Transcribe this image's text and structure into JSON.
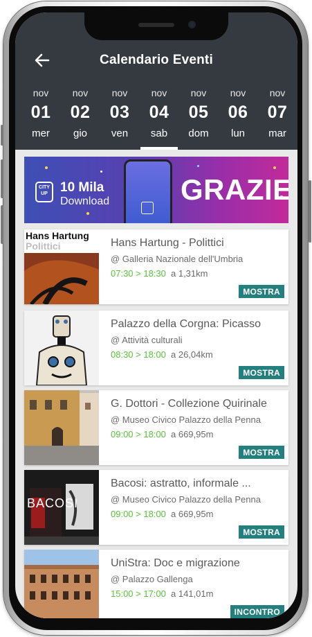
{
  "header": {
    "title": "Calendario Eventi",
    "days": [
      {
        "month": "nov",
        "num": "01",
        "weekday": "mer",
        "active": false
      },
      {
        "month": "nov",
        "num": "02",
        "weekday": "gio",
        "active": false
      },
      {
        "month": "nov",
        "num": "03",
        "weekday": "ven",
        "active": false
      },
      {
        "month": "nov",
        "num": "04",
        "weekday": "sab",
        "active": true
      },
      {
        "month": "nov",
        "num": "05",
        "weekday": "dom",
        "active": false
      },
      {
        "month": "nov",
        "num": "06",
        "weekday": "lun",
        "active": false
      },
      {
        "month": "nov",
        "num": "07",
        "weekday": "mar",
        "active": false
      }
    ]
  },
  "banner": {
    "logo_line1": "CITY",
    "logo_line2": "UP",
    "mila": "10 Mila",
    "download": "Download",
    "grazie": "GRAZIE"
  },
  "events": [
    {
      "title": "Hans Hartung - Polittici",
      "venue": "@ Galleria Nazionale dell'Umbria",
      "time": "07:30 > 18:30",
      "distance": "a 1,31km",
      "tag": "MOSTRA",
      "thumb_text1": "Hans Hartung",
      "thumb_text2": "Polittici"
    },
    {
      "title": "Palazzo della Corgna: Picasso",
      "venue": "@ Attività culturali",
      "time": "08:30 > 18:00",
      "distance": "a 26,04km",
      "tag": "MOSTRA"
    },
    {
      "title": "G. Dottori - Collezione Quirinale",
      "venue": "@ Museo Civico Palazzo della Penna",
      "time": "09:00 > 18:00",
      "distance": "a 669,95m",
      "tag": "MOSTRA"
    },
    {
      "title": "Bacosi: astratto, informale ...",
      "venue": "@ Museo Civico Palazzo della Penna",
      "time": "09:00 > 18:00",
      "distance": "a 669,95m",
      "tag": "MOSTRA",
      "thumb_text1": "BACOSI"
    },
    {
      "title": "UniStra: Doc e migrazione",
      "venue": "@ Palazzo Gallenga",
      "time": "15:00 > 17:00",
      "distance": "a 141,01m",
      "tag": "INCONTRO"
    }
  ],
  "colors": {
    "header_bg": "#343a40",
    "time_green": "#59c33a",
    "tag_teal": "#24807f"
  }
}
